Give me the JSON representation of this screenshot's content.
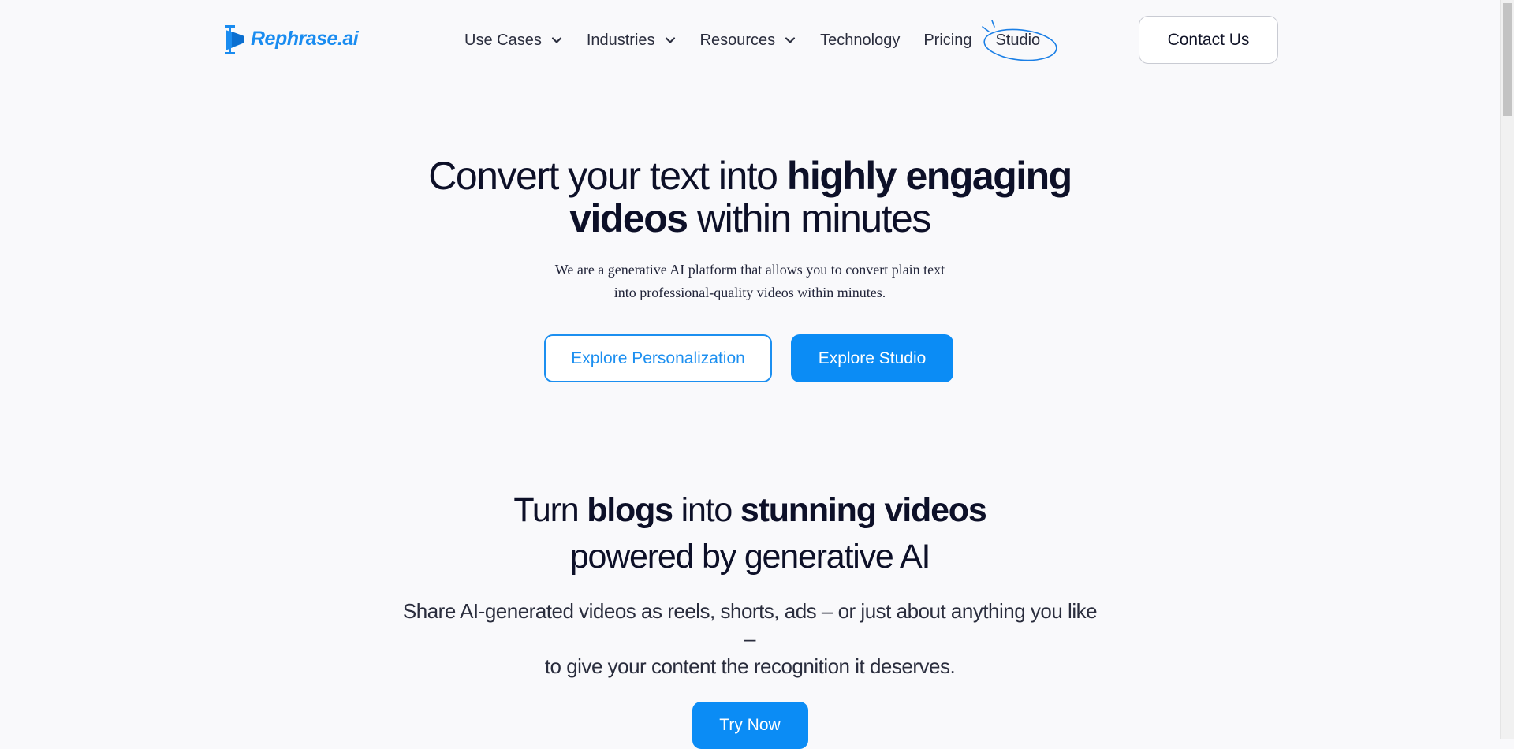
{
  "header": {
    "logo_text": "Rephrase.ai",
    "nav": {
      "use_cases": "Use Cases",
      "industries": "Industries",
      "resources": "Resources",
      "technology": "Technology",
      "pricing": "Pricing",
      "studio": "Studio"
    },
    "contact_label": "Contact Us"
  },
  "hero": {
    "title_part1": "Convert your text into ",
    "title_bold1": "highly engaging",
    "title_bold2": "videos",
    "title_part2": " within minutes",
    "subtitle_line1": "We are a generative AI platform that allows you to convert plain text",
    "subtitle_line2": "into professional-quality videos within minutes.",
    "btn_personalization": "Explore Personalization",
    "btn_studio": "Explore Studio"
  },
  "section2": {
    "title_part1": "Turn ",
    "title_bold1": "blogs",
    "title_part2": " into ",
    "title_bold2": "stunning videos",
    "title_line2": "powered by generative AI",
    "subtitle_line1": "Share AI-generated videos as reels, shorts, ads – or just about anything you like –",
    "subtitle_line2": "to give your content the recognition it deserves.",
    "try_label": "Try Now"
  },
  "colors": {
    "accent": "#0b8cf5",
    "background": "#f9f9fb",
    "text": "#0d1028"
  },
  "icons": {
    "logo": "rephrase-logo-icon",
    "dropdown": "chevron-down-icon"
  }
}
